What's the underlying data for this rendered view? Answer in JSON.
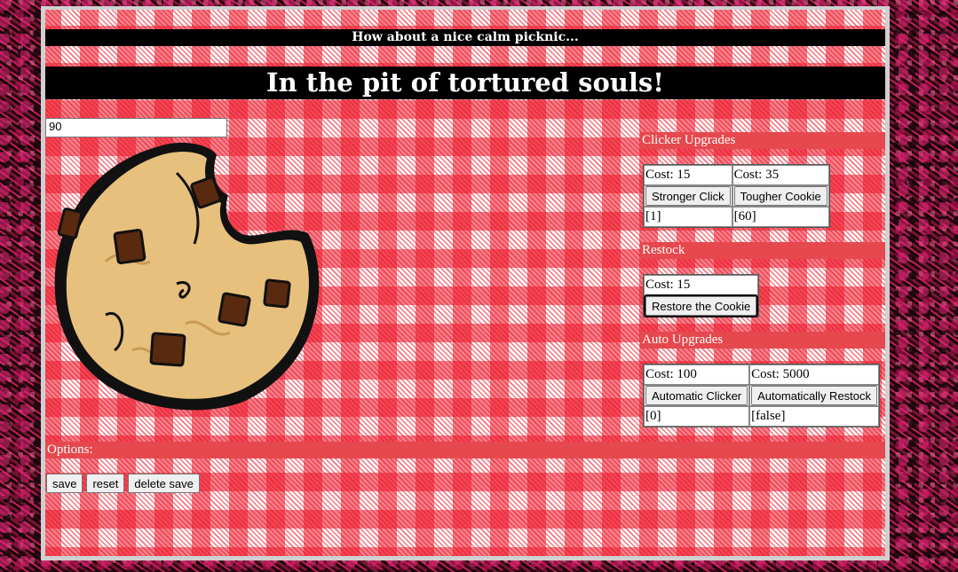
{
  "header": {
    "subtitle": "How about a nice calm picknic...",
    "title": "In the pit of tortured souls!"
  },
  "counter": {
    "value": "90"
  },
  "clicker_upgrades": {
    "heading": "Clicker Upgrades",
    "items": [
      {
        "cost": "Cost: 15",
        "button": "Stronger Click",
        "level": "[1]"
      },
      {
        "cost": "Cost: 35",
        "button": "Tougher Cookie",
        "level": "[60]"
      }
    ]
  },
  "restock": {
    "heading": "Restock",
    "cost": "Cost: 15",
    "button": "Restore the Cookie"
  },
  "auto_upgrades": {
    "heading": "Auto Upgrades",
    "items": [
      {
        "cost": "Cost: 100",
        "button": "Automatic Clicker",
        "level": "[0]"
      },
      {
        "cost": "Cost: 5000",
        "button": "Automatically Restock",
        "level": "[false]"
      }
    ]
  },
  "options": {
    "heading": "Options:",
    "buttons": [
      "save",
      "reset",
      "delete save"
    ]
  },
  "colors": {
    "checker_red": "#ec182a",
    "section_header": "#e5484d",
    "banner_bg": "#000000",
    "cookie_dough": "#e8c07d",
    "chocolate_chip": "#5a2a10"
  }
}
